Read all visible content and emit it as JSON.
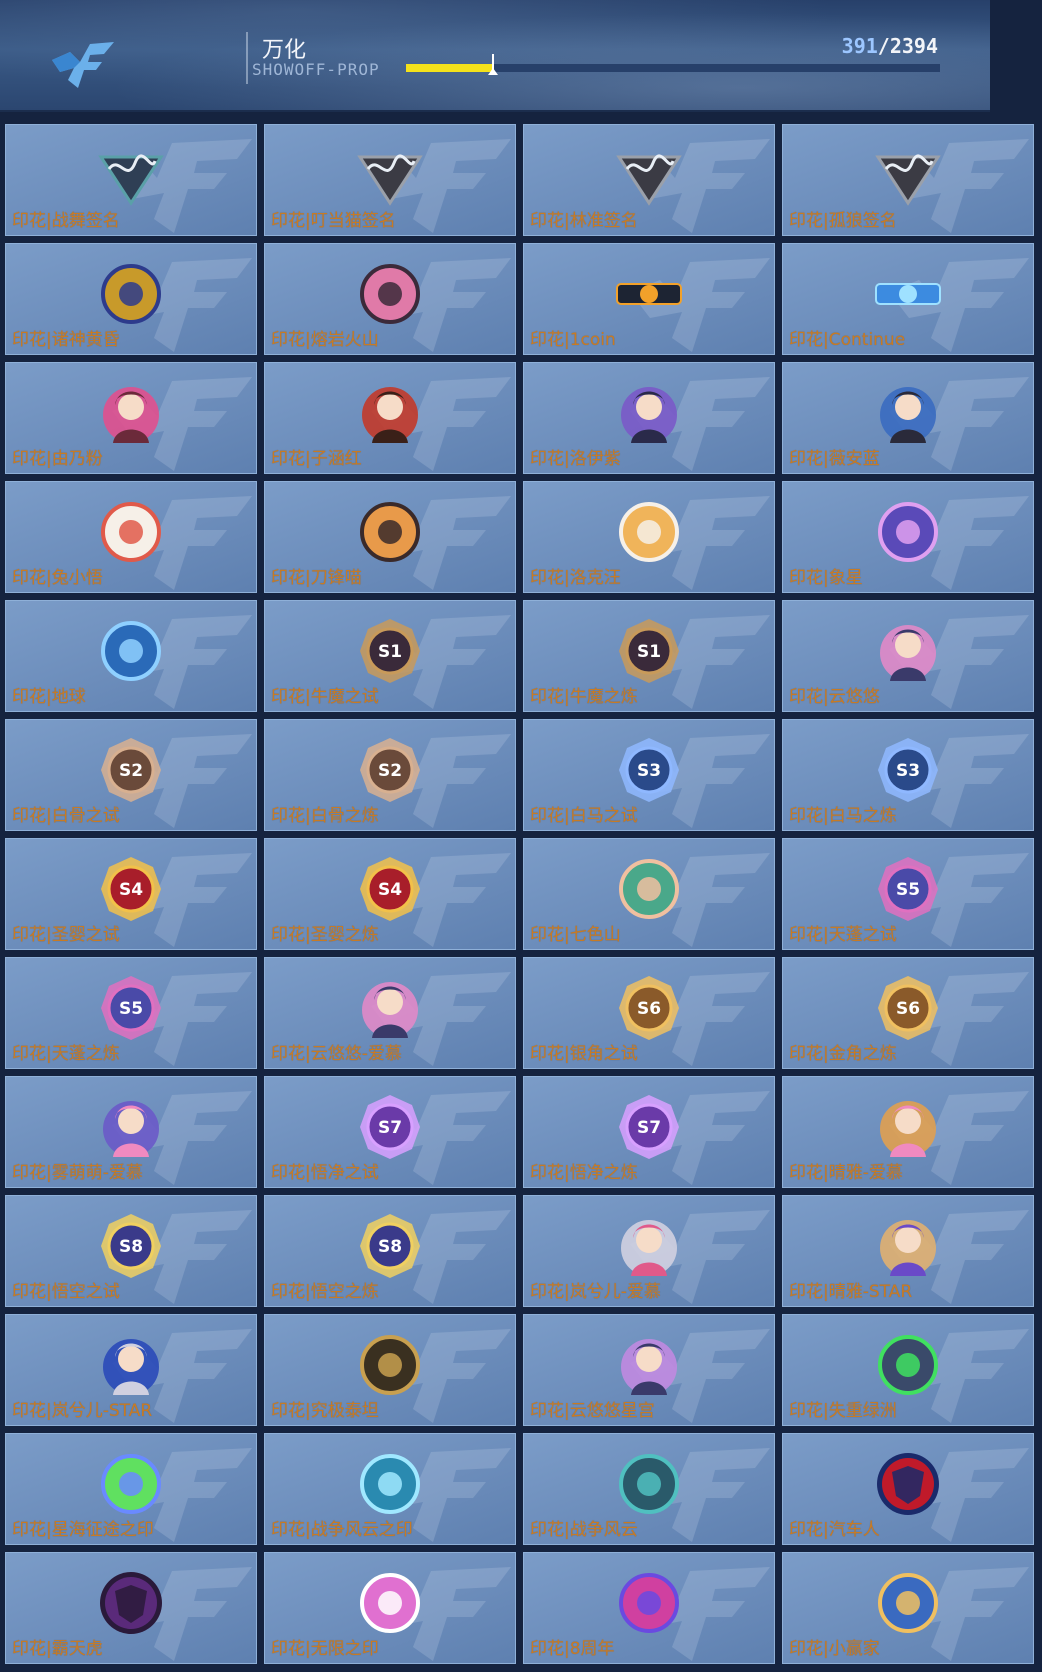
{
  "header": {
    "title": "万化",
    "subtitle": "SHOWOFF-PROP",
    "progress_current": "391",
    "progress_total": "2394",
    "progress_fraction": 0.163,
    "logo_icon": "cf-logo-icon",
    "accent_color": "#f4e21b"
  },
  "label_color": "#c87b24",
  "items": [
    {
      "label": "印花|战舞签名",
      "icon": "signature-badge-icon",
      "color": "#2f3f55",
      "accent": "#5aa0a8"
    },
    {
      "label": "印花|叮当猫签名",
      "icon": "signature-badge-icon",
      "color": "#3b3b44",
      "accent": "#9aa0aa"
    },
    {
      "label": "印花|林准签名",
      "icon": "signature-badge-icon",
      "color": "#3b3b44",
      "accent": "#9aa0aa"
    },
    {
      "label": "印花|孤狼签名",
      "icon": "signature-badge-icon",
      "color": "#3b3b44",
      "accent": "#9aa0aa"
    },
    {
      "label": "印花|诸神黄昏",
      "icon": "golden-crest-icon",
      "color": "#c89a2a",
      "accent": "#2d3b8c"
    },
    {
      "label": "印花|熔岩火山",
      "icon": "volcano-icon",
      "color": "#e07aa8",
      "accent": "#3b2a3a"
    },
    {
      "label": "印花|1coin",
      "icon": "coin-logo-icon",
      "color": "#1d2433",
      "accent": "#f2a12a"
    },
    {
      "label": "印花|Continue",
      "icon": "continue-logo-icon",
      "color": "#3c8be0",
      "accent": "#9fe1ff"
    },
    {
      "label": "印花|由乃粉",
      "icon": "character-portrait-icon",
      "color": "#e0508e",
      "accent": "#6b2a3a"
    },
    {
      "label": "印花|子涵红",
      "icon": "heart-character-icon",
      "color": "#c23a2a",
      "accent": "#3a2018"
    },
    {
      "label": "印花|洛伊紫",
      "icon": "character-portrait-icon",
      "color": "#7a5ac8",
      "accent": "#2a2a4a"
    },
    {
      "label": "印花|薇安蓝",
      "icon": "character-portrait-icon",
      "color": "#3a6cc0",
      "accent": "#2a2a3a"
    },
    {
      "label": "印花|兔小悟",
      "icon": "rabbit-icon",
      "color": "#f6f0e8",
      "accent": "#e05a4a"
    },
    {
      "label": "印花|刀锋喵",
      "icon": "cat-icon",
      "color": "#e89a4a",
      "accent": "#3a2a2a"
    },
    {
      "label": "印花|洛克汪",
      "icon": "dog-icon",
      "color": "#f0b45a",
      "accent": "#f6f0e8"
    },
    {
      "label": "印花|象星",
      "icon": "planet-icon",
      "color": "#5a4ab8",
      "accent": "#e0a0f0"
    },
    {
      "label": "印花|地球",
      "icon": "earth-badge-icon",
      "color": "#2a6ab8",
      "accent": "#8fd0ff"
    },
    {
      "label": "印花|牛魔之试",
      "icon": "season-badge-s1-icon",
      "color": "#3a2a3a",
      "accent": "#c89a5a"
    },
    {
      "label": "印花|牛魔之炼",
      "icon": "season-badge-s1-icon",
      "color": "#3a2a3a",
      "accent": "#c89a5a"
    },
    {
      "label": "印花|云悠悠",
      "icon": "character-portrait-icon",
      "color": "#e08ac8",
      "accent": "#3a3a6a"
    },
    {
      "label": "印花|白骨之试",
      "icon": "season-badge-s2-icon",
      "color": "#6a4a3a",
      "accent": "#d8b090"
    },
    {
      "label": "印花|白骨之炼",
      "icon": "season-badge-s2-icon",
      "color": "#6a4a3a",
      "accent": "#d8b090"
    },
    {
      "label": "印花|白马之试",
      "icon": "season-badge-s3-icon",
      "color": "#2a4a8a",
      "accent": "#8fb8ff"
    },
    {
      "label": "印花|白马之炼",
      "icon": "season-badge-s3-icon",
      "color": "#2a4a8a",
      "accent": "#8fb8ff"
    },
    {
      "label": "印花|圣婴之试",
      "icon": "season-badge-s4-icon",
      "color": "#a81e2a",
      "accent": "#f2c14a"
    },
    {
      "label": "印花|圣婴之炼",
      "icon": "season-badge-s4-icon",
      "color": "#a81e2a",
      "accent": "#f2c14a"
    },
    {
      "label": "印花|七色山",
      "icon": "rainbow-mountain-icon",
      "color": "#4aa88a",
      "accent": "#f0c0a0"
    },
    {
      "label": "印花|天蓬之试",
      "icon": "season-badge-s5-icon",
      "color": "#4a4aa8",
      "accent": "#e070c0"
    },
    {
      "label": "印花|天蓬之炼",
      "icon": "season-badge-s5-icon",
      "color": "#4a4aa8",
      "accent": "#e070c0"
    },
    {
      "label": "印花|云悠悠-爱慕",
      "icon": "character-portrait-icon",
      "color": "#e08ac8",
      "accent": "#3a3a6a"
    },
    {
      "label": "印花|银角之试",
      "icon": "season-badge-s6-icon",
      "color": "#8a5a2a",
      "accent": "#f0c060"
    },
    {
      "label": "印花|金角之炼",
      "icon": "season-badge-s6-icon",
      "color": "#8a5a2a",
      "accent": "#f0c060"
    },
    {
      "label": "印花|雾萌萌-爱慕",
      "icon": "character-portrait-icon",
      "color": "#6a5ac8",
      "accent": "#f08ac0"
    },
    {
      "label": "印花|悟净之试",
      "icon": "season-badge-s7-icon",
      "color": "#6a3aa8",
      "accent": "#d8a0ff"
    },
    {
      "label": "印花|悟净之炼",
      "icon": "season-badge-s7-icon",
      "color": "#6a3aa8",
      "accent": "#d8a0ff"
    },
    {
      "label": "印花|晴雅-爱慕",
      "icon": "character-portrait-icon",
      "color": "#e0a050",
      "accent": "#f08ac0"
    },
    {
      "label": "印花|悟空之试",
      "icon": "season-badge-s8-icon",
      "color": "#3a3a8a",
      "accent": "#f0d060"
    },
    {
      "label": "印花|悟空之炼",
      "icon": "season-badge-s8-icon",
      "color": "#3a3a8a",
      "accent": "#f0d060"
    },
    {
      "label": "印花|岚兮儿-爱慕",
      "icon": "character-portrait-icon",
      "color": "#d0d0e0",
      "accent": "#e05a8a"
    },
    {
      "label": "印花|晴雅-STAR",
      "icon": "character-portrait-icon",
      "color": "#e0b070",
      "accent": "#6a4ac8"
    },
    {
      "label": "印花|岚兮儿-STAR",
      "icon": "character-portrait-icon",
      "color": "#2a4ab8",
      "accent": "#d0d0e0"
    },
    {
      "label": "印花|究极泰坦",
      "icon": "titan-icon",
      "color": "#3a3020",
      "accent": "#c8a050"
    },
    {
      "label": "印花|云悠悠星宫",
      "icon": "character-portrait-icon",
      "color": "#c08ae0",
      "accent": "#3a3a6a"
    },
    {
      "label": "印花|失重绿洲",
      "icon": "spaceship-orbit-icon",
      "color": "#3a4a6a",
      "accent": "#40e060"
    },
    {
      "label": "印花|星海征途之印",
      "icon": "star-sea-emblem-icon",
      "color": "#60e060",
      "accent": "#6a8aff"
    },
    {
      "label": "印花|战争风云之印",
      "icon": "war-emblem-icon",
      "color": "#2a8ab0",
      "accent": "#a0e8ff"
    },
    {
      "label": "印花|战争风云",
      "icon": "fighter-jet-icon",
      "color": "#2a5a6a",
      "accent": "#50c0c0"
    },
    {
      "label": "印花|汽车人",
      "icon": "autobot-logo-icon",
      "color": "#c01a2a",
      "accent": "#1a2a6a"
    },
    {
      "label": "印花|霸天虎",
      "icon": "decepticon-logo-icon",
      "color": "#5a2a7a",
      "accent": "#2a1a3a"
    },
    {
      "label": "印花|无限之印",
      "icon": "infinity-emblem-icon",
      "color": "#e070d0",
      "accent": "#ffffff"
    },
    {
      "label": "印花|8周年",
      "icon": "anniversary-8-icon",
      "color": "#d040a0",
      "accent": "#6a4ae0"
    },
    {
      "label": "印花|小赢家",
      "icon": "little-winner-icon",
      "color": "#3a6ac0",
      "accent": "#f0c060"
    }
  ]
}
